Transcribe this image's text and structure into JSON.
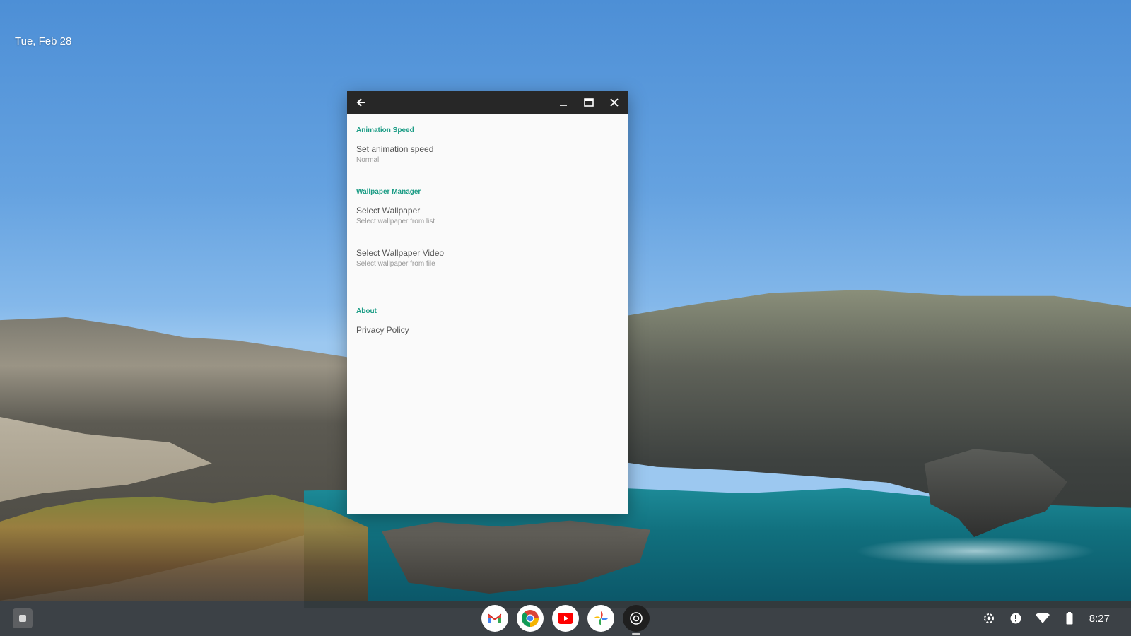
{
  "desktop": {
    "date": "Tue, Feb 28"
  },
  "window": {
    "sections": [
      {
        "header": "Animation Speed",
        "items": [
          {
            "title": "Set animation speed",
            "summary": "Normal"
          }
        ]
      },
      {
        "header": "Wallpaper Manager",
        "items": [
          {
            "title": "Select Wallpaper",
            "summary": "Select wallpaper from list"
          },
          {
            "title": "Select Wallpaper Video",
            "summary": "Select wallpaper from file"
          }
        ]
      },
      {
        "header": "About",
        "items": [
          {
            "title": "Privacy Policy"
          }
        ]
      }
    ],
    "titlebar_icons": [
      "back-arrow-icon",
      "minimize-icon",
      "restore-icon",
      "close-icon"
    ]
  },
  "shelf": {
    "apps": [
      "gmail-icon",
      "chrome-icon",
      "youtube-icon",
      "photos-icon",
      "camera-app-icon"
    ],
    "tray": {
      "time": "8:27",
      "icons": [
        "settings-icon",
        "notification-icon",
        "wifi-icon",
        "battery-icon"
      ]
    }
  },
  "colors": {
    "accent": "#1b9c85",
    "titlebar": "#272727",
    "shelf": "#36383a"
  }
}
